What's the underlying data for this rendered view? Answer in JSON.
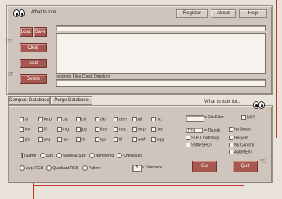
{
  "header": {
    "what_to_look": "What to look",
    "register": "Register",
    "about": "About",
    "help": "Help"
  },
  "left_buttons": {
    "load": "Load",
    "save": "Save",
    "clear": "Clear",
    "add": "Add",
    "delete": "Delete"
  },
  "dir_panel": {
    "incoming_label": "Incoming Files Check Directory"
  },
  "tabs": {
    "compact": "Compact Database",
    "purge": "Purge Database"
  },
  "search_header": {
    "what_to_look_for": "What to look for..."
  },
  "extensions": [
    [
      "ai",
      "bmp",
      "cut",
      "cvl",
      "dib",
      "gem",
      "gif",
      "hrz"
    ],
    [
      "ico",
      "iff",
      "img",
      "jpg",
      "lbm",
      "mac",
      "mop",
      "pcx"
    ],
    [
      "pic",
      "png",
      "ras",
      "rle",
      "tga",
      "tif",
      "wmf",
      "wpg"
    ]
  ],
  "options": {
    "file_filter": "= File Filter",
    "not": "NOT",
    "thumb_value": "THN",
    "thumb": "= Thumb",
    "no_sound": "No Sound",
    "soft_matching": "SOFT matching",
    "recycle": "Recycle",
    "snapshot": "SNAPSHOT",
    "no_confirm": "No Confirm",
    "autonext": "AutoNEXT"
  },
  "match": {
    "row1": [
      "Name",
      "Size",
      "Name & Size",
      "Numbered",
      "Checksum"
    ],
    "row2": [
      "Avg. RGB",
      "Quadrant RGB",
      "Pattern"
    ],
    "tolerance_value": "5",
    "tolerance": "= Tolerance"
  },
  "actions": {
    "go": "Go",
    "quit": "Quit"
  },
  "colors": {
    "accent": "#a7574f",
    "background": "#e9e2da",
    "panel": "#cfc5bd",
    "red_line": "#c2362c"
  }
}
